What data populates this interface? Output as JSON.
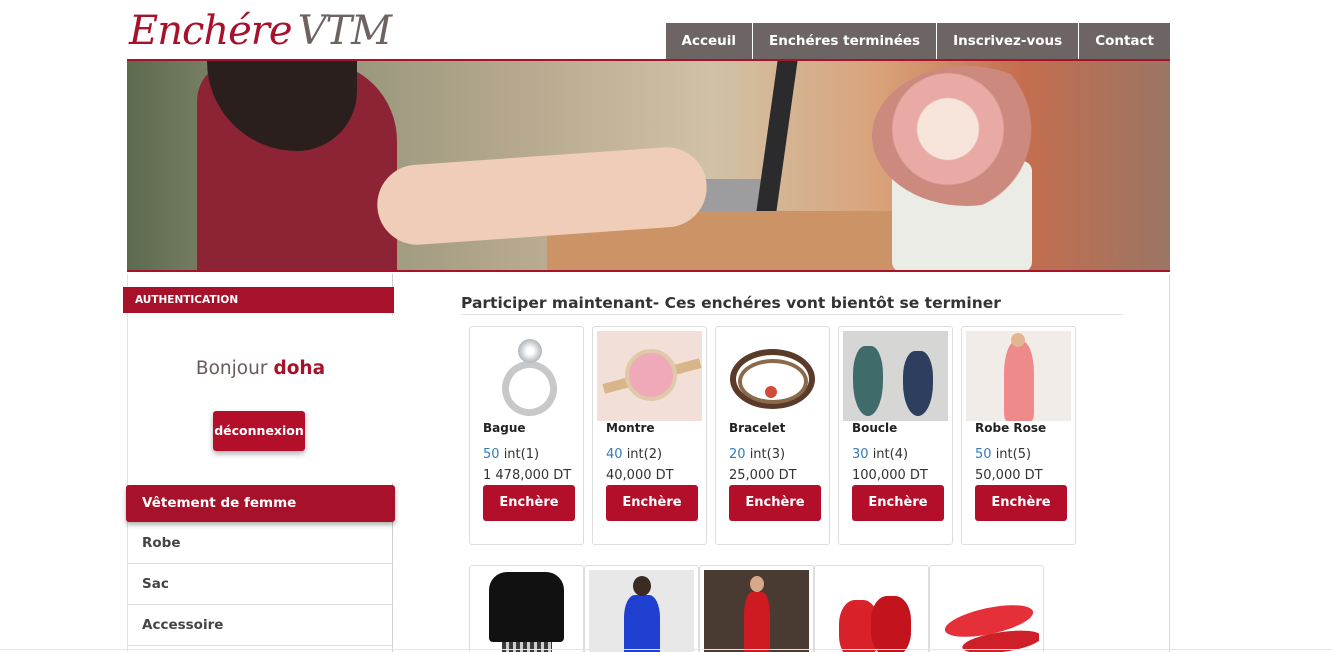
{
  "logo": {
    "part1": "Enchére",
    "part2": "VTM"
  },
  "nav": [
    {
      "label": "Acceuil"
    },
    {
      "label": "Enchéres terminées"
    },
    {
      "label": "Inscrivez-vous"
    },
    {
      "label": "Contact"
    }
  ],
  "auth": {
    "header": "AUTHENTICATION",
    "greeting": "Bonjour",
    "username": "doha",
    "logout_label": "déconnexion"
  },
  "categories": {
    "header": "Vêtement de femme",
    "items": [
      "Robe",
      "Sac",
      "Accessoire"
    ]
  },
  "main": {
    "title": "Participer maintenant- Ces enchéres vont bientôt se terminer",
    "bid_button_label": "Enchère",
    "products": [
      {
        "name": "Bague",
        "bids": "50",
        "count": "int(1)",
        "price": "1 478,000 DT"
      },
      {
        "name": "Montre",
        "bids": "40",
        "count": "int(2)",
        "price": "40,000 DT"
      },
      {
        "name": "Bracelet",
        "bids": "20",
        "count": "int(3)",
        "price": "25,000 DT"
      },
      {
        "name": "Boucle",
        "bids": "30",
        "count": "int(4)",
        "price": "100,000 DT"
      },
      {
        "name": "Robe Rose",
        "bids": "50",
        "count": "int(5)",
        "price": "50,000 DT"
      }
    ]
  },
  "colors": {
    "brand": "#a8112a",
    "nav": "#6d6464",
    "link": "#337ab7"
  }
}
